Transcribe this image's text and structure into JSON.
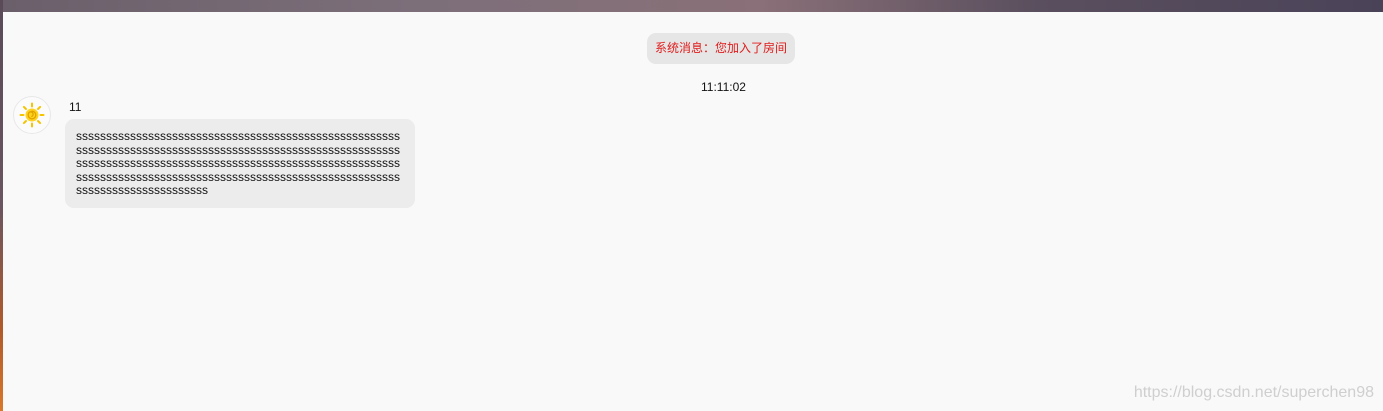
{
  "system_message": {
    "text": "系统消息：您加入了房间"
  },
  "timestamp": "11:11:02",
  "messages": [
    {
      "sender": "11",
      "avatar_icon": "sun-icon",
      "text": "ssssssssssssssssssssssssssssssssssssssssssssssssssssssssssssssssssssssssssssssssssssssssssssssssssssssssssssssssssssssssssssssssssssssssssssssssssssssssssssssssssssssssssssssssssssssssssssssssssssssssssssssssssssssssssssssssssssssssssssss"
    }
  ],
  "watermark": "https://blog.csdn.net/superchen98",
  "colors": {
    "system_text": "#e01c1c",
    "bubble_bg": "#ececec",
    "panel_bg": "#f9f9f9",
    "avatar_sun": "#f5c400"
  }
}
